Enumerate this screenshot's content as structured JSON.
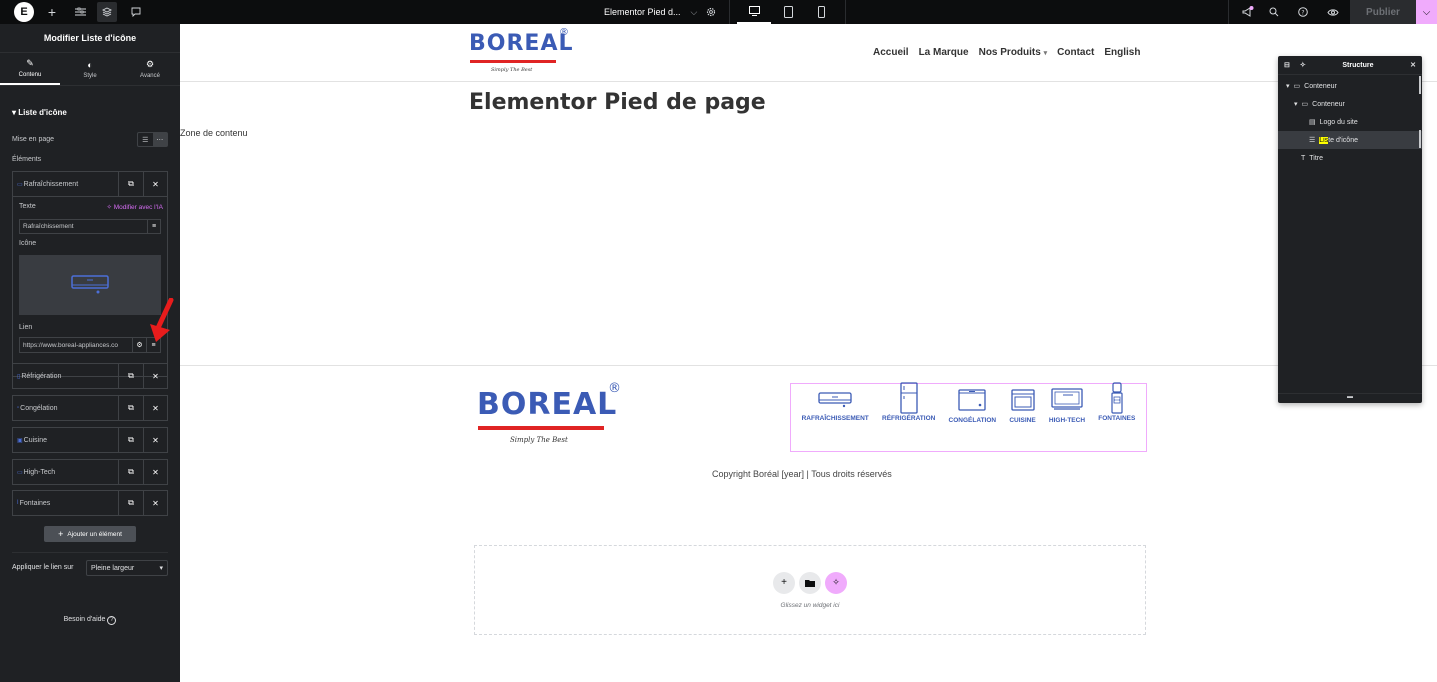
{
  "topbar": {
    "document_title": "Elementor Pied d...",
    "publish_label": "Publier",
    "icons": [
      "elementor-logo-icon",
      "add-icon",
      "site-settings-icon",
      "structure-icon",
      "notes-icon"
    ],
    "right_icons": [
      "whats-new-icon",
      "search-icon",
      "help-icon",
      "preview-icon"
    ],
    "devices": [
      "desktop",
      "tablet",
      "mobile"
    ]
  },
  "panel": {
    "title": "Modifier Liste d'icône",
    "tabs": [
      {
        "label": "Contenu",
        "icon": "pencil-icon",
        "active": true
      },
      {
        "label": "Style",
        "icon": "contrast-icon",
        "active": false
      },
      {
        "label": "Avancé",
        "icon": "gear-icon",
        "active": false
      }
    ],
    "section_title": "Liste d'icône",
    "layout_label": "Mise en page",
    "elements_label": "Éléments",
    "items": [
      {
        "label": "Rafraîchissement",
        "expanded": true
      },
      {
        "label": "Réfrigération"
      },
      {
        "label": "Congélation"
      },
      {
        "label": "Cuisine"
      },
      {
        "label": "High-Tech"
      },
      {
        "label": "Fontaines"
      }
    ],
    "item_editor": {
      "text_label": "Texte",
      "ai_label": "Modifier avec l'IA",
      "text_value": "Rafraîchissement",
      "icon_label": "Icône",
      "link_label": "Lien",
      "link_value": "https://www.boreal-appliances.co"
    },
    "add_item_label": "Ajouter un élément",
    "apply_link_label": "Appliquer le lien sur",
    "apply_link_value": "Pleine largeur",
    "help_label": "Besoin d'aide"
  },
  "canvas": {
    "logo_text": "BOREAL",
    "logo_mark": "®",
    "tagline": "Simply The Best",
    "nav": [
      "Accueil",
      "La Marque",
      "Nos Produits",
      "Contact",
      "English"
    ],
    "nav_dropdown_marker": "▾",
    "page_title": "Elementor Pied de page",
    "content_zone": "Zone de contenu",
    "footer_icons": [
      {
        "label": "RAFRAÎCHISSEMENT",
        "icon": "air-conditioner-icon"
      },
      {
        "label": "RÉFRIGÉRATION",
        "icon": "fridge-icon"
      },
      {
        "label": "CONGÉLATION",
        "icon": "freezer-icon"
      },
      {
        "label": "CUISINE",
        "icon": "oven-icon"
      },
      {
        "label": "HIGH-TECH",
        "icon": "tv-icon"
      },
      {
        "label": "FONTAINES",
        "icon": "water-fountain-icon"
      }
    ],
    "copyright": "Copyright Boréal [year] | Tous droits réservés",
    "dropzone_text": "Glissez un widget ici"
  },
  "structure": {
    "title": "Structure",
    "tree": [
      {
        "label": "Conteneur",
        "level": 0,
        "icon": "container-icon"
      },
      {
        "label": "Conteneur",
        "level": 1,
        "icon": "container-icon"
      },
      {
        "label": "Logo du site",
        "level": 2,
        "icon": "site-logo-icon"
      },
      {
        "label_highlight": "Lis",
        "label_rest": "te d'icône",
        "level": 2,
        "icon": "icon-list-icon",
        "selected": true
      },
      {
        "label": "Titre",
        "level": 1,
        "icon": "heading-icon"
      }
    ]
  },
  "colors": {
    "accent": "#f0abfc",
    "brand_blue": "#3b5bb5",
    "brand_red": "#e02424",
    "panel_bg": "#1f2124",
    "topbar_bg": "#0c0d0e"
  }
}
